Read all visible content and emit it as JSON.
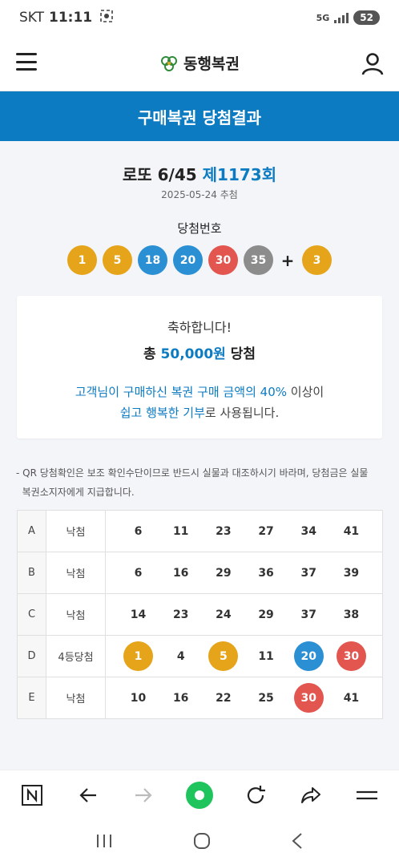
{
  "status_bar": {
    "carrier": "SKT",
    "time": "11:11",
    "network": "5G",
    "battery": "52"
  },
  "header": {
    "logo_text": "동행복권",
    "menu_icon": "hamburger-icon",
    "user_icon": "user-icon"
  },
  "banner": {
    "title": "구매복권 당첨결과"
  },
  "draw": {
    "game": "로또 6/45",
    "round": "제1173회",
    "date": "2025-05-24 추첨",
    "winning_label": "당첨번호",
    "numbers": [
      {
        "value": "1",
        "color": "#e5a419"
      },
      {
        "value": "5",
        "color": "#e5a419"
      },
      {
        "value": "18",
        "color": "#2b8fd4"
      },
      {
        "value": "20",
        "color": "#2b8fd4"
      },
      {
        "value": "30",
        "color": "#e2564f"
      },
      {
        "value": "35",
        "color": "#8c8c8c"
      }
    ],
    "plus": "+",
    "bonus": {
      "value": "3",
      "color": "#e5a419"
    }
  },
  "result_card": {
    "congrats": "축하합니다!",
    "total_prefix": "총",
    "total_amount": "50,000원",
    "total_suffix": "당첨",
    "msg_line1_hl": "고객님이 구매하신 복권 구매 금액의 40%",
    "msg_line1_rest": " 이상이",
    "msg_line2_hl": "쉽고 행복한 기부",
    "msg_line2_rest": "로 사용됩니다."
  },
  "notice": {
    "line1": "- QR 당첨확인은 보조 확인수단이므로 반드시 실물과 대조하시기 바라며, 당첨금은 실물",
    "line2": "  복권소지자에게 지급합니다."
  },
  "tickets": [
    {
      "letter": "A",
      "status": "낙첨",
      "numbers": [
        {
          "value": "6"
        },
        {
          "value": "11"
        },
        {
          "value": "23"
        },
        {
          "value": "27"
        },
        {
          "value": "34"
        },
        {
          "value": "41"
        }
      ]
    },
    {
      "letter": "B",
      "status": "낙첨",
      "numbers": [
        {
          "value": "6"
        },
        {
          "value": "16"
        },
        {
          "value": "29"
        },
        {
          "value": "36"
        },
        {
          "value": "37"
        },
        {
          "value": "39"
        }
      ]
    },
    {
      "letter": "C",
      "status": "낙첨",
      "numbers": [
        {
          "value": "14"
        },
        {
          "value": "23"
        },
        {
          "value": "24"
        },
        {
          "value": "29"
        },
        {
          "value": "37"
        },
        {
          "value": "38"
        }
      ]
    },
    {
      "letter": "D",
      "status": "4등당첨",
      "numbers": [
        {
          "value": "1",
          "hit": true,
          "color": "#e5a419"
        },
        {
          "value": "4"
        },
        {
          "value": "5",
          "hit": true,
          "color": "#e5a419"
        },
        {
          "value": "11"
        },
        {
          "value": "20",
          "hit": true,
          "color": "#2b8fd4"
        },
        {
          "value": "30",
          "hit": true,
          "color": "#e2564f"
        }
      ]
    },
    {
      "letter": "E",
      "status": "낙첨",
      "numbers": [
        {
          "value": "10"
        },
        {
          "value": "16"
        },
        {
          "value": "22"
        },
        {
          "value": "25"
        },
        {
          "value": "30",
          "hit": true,
          "color": "#e2564f"
        },
        {
          "value": "41"
        }
      ]
    }
  ],
  "browser_bar": [
    "n-icon",
    "back-arrow-icon",
    "forward-arrow-icon",
    "home-circle-icon",
    "reload-icon",
    "share-icon",
    "menu-lines-icon"
  ],
  "nav_bar": [
    "recent-apps-icon",
    "home-icon",
    "back-icon"
  ],
  "colors": {
    "brand_blue": "#0c7bc2",
    "yellow": "#e5a419",
    "blue": "#2b8fd4",
    "red": "#e2564f",
    "gray": "#8c8c8c",
    "green": "#1fc45c"
  }
}
